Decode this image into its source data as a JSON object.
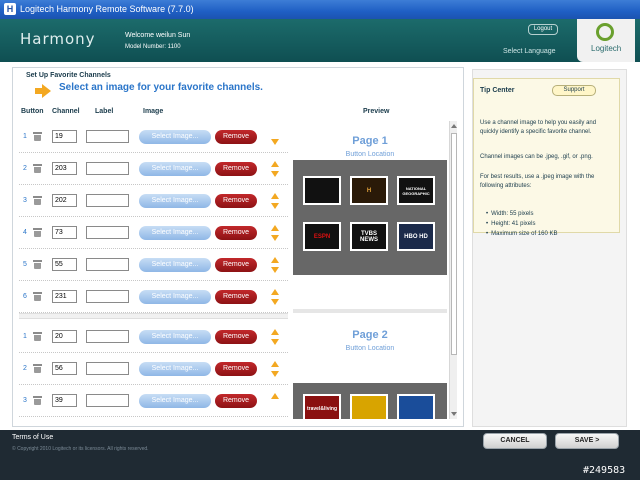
{
  "window": {
    "title": "Logitech Harmony Remote Software (7.7.0)"
  },
  "header": {
    "logo": "Harmony",
    "welcome": "Welcome weilun Sun",
    "model": "Model Number: 1100",
    "logout": "Logout",
    "select_language": "Select Language",
    "brand": "Logitech"
  },
  "main": {
    "section_title": "Set Up Favorite Channels",
    "subtitle": "Select an image for your favorite channels.",
    "columns": {
      "button": "Button",
      "channel": "Channel",
      "label": "Label",
      "image": "Image",
      "preview": "Preview"
    },
    "select_label": "Select Image...",
    "remove_label": "Remove",
    "rows": [
      {
        "num": "1",
        "channel": "19",
        "label": ""
      },
      {
        "num": "2",
        "channel": "203",
        "label": ""
      },
      {
        "num": "3",
        "channel": "202",
        "label": ""
      },
      {
        "num": "4",
        "channel": "73",
        "label": ""
      },
      {
        "num": "5",
        "channel": "55",
        "label": ""
      },
      {
        "num": "6",
        "channel": "231",
        "label": ""
      },
      {
        "num": "1",
        "channel": "20",
        "label": ""
      },
      {
        "num": "2",
        "channel": "56",
        "label": ""
      },
      {
        "num": "3",
        "channel": "39",
        "label": ""
      }
    ]
  },
  "preview": {
    "page1_title": "Page 1",
    "page2_title": "Page 2",
    "button_location": "Button Location",
    "page1_tiles": [
      "",
      "H",
      "NATIONAL GEOGRAPHIC",
      "ESPN",
      "TVBS NEWS",
      "HBO HD"
    ],
    "page2_tiles": [
      "travel&living",
      "",
      ""
    ]
  },
  "tips": {
    "title": "Tip Center",
    "support": "Support",
    "p1": "Use a channel image to help you easily and quickly identify a specific favorite channel.",
    "p2": "Channel images can be .jpeg, .gif, or .png.",
    "p3": "For best results, use a .jpeg image with the following attributes:",
    "bullets": [
      "Width: 55 pixels",
      "Height: 41 pixels",
      "Maximum size of 160 KB"
    ]
  },
  "footer": {
    "terms": "Terms of Use",
    "copyright": "© Copyright 2010 Logitech or its licensors. All rights reserved.",
    "cancel": "CANCEL",
    "save": "SAVE >"
  },
  "watermark": "#249583"
}
